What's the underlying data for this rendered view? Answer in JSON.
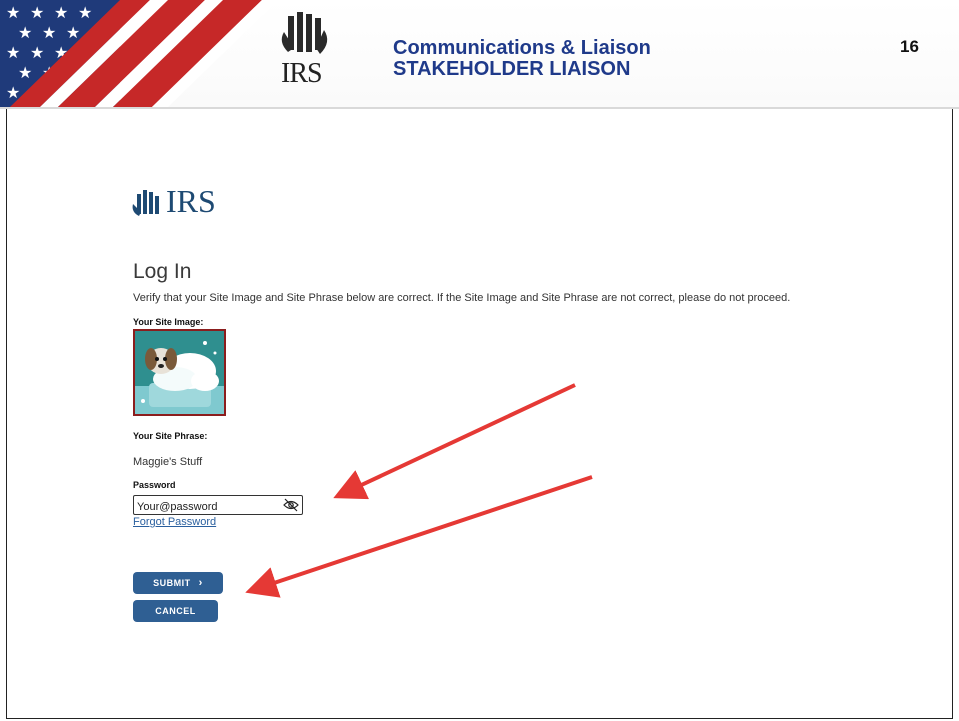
{
  "header": {
    "title_line1": "Communications & Liaison",
    "title_line2": "STAKEHOLDER LIAISON",
    "slide_number": "16",
    "logo_text": "IRS"
  },
  "page": {
    "logo_text": "IRS",
    "heading": "Log In",
    "verify_text": "Verify that your Site Image and Site Phrase below are correct. If the Site Image and Site Phrase are not correct, please do not proceed.",
    "site_image_label": "Your Site Image:",
    "site_phrase_label": "Your Site Phrase:",
    "site_phrase": "Maggie's Stuff",
    "password_label": "Password",
    "password_value": "Your@password",
    "forgot_link": "Forgot Password",
    "submit_label": "SUBMIT",
    "cancel_label": "CANCEL"
  },
  "colors": {
    "header_title": "#1f3a8a",
    "button": "#2f5f93",
    "arrow": "#e53935",
    "site_image_border": "#8b1d1d"
  },
  "icons": [
    "flag-graphic",
    "irs-eagle-logo",
    "eye-slash-icon",
    "chevron-right-icon",
    "red-arrow"
  ]
}
